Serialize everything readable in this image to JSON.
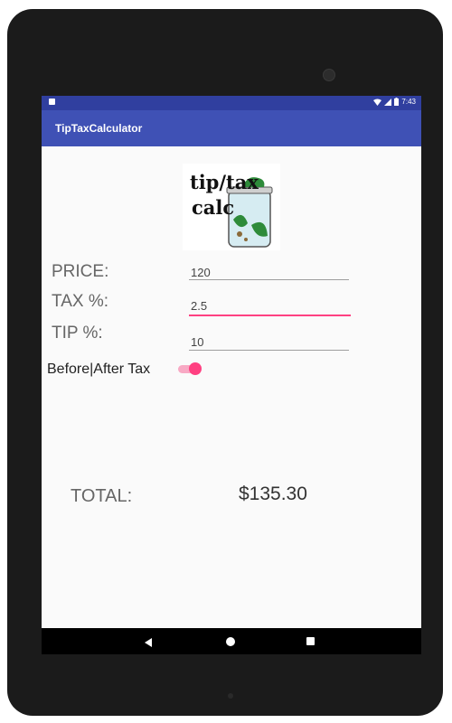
{
  "app": {
    "title": "TipTaxCalculator"
  },
  "status": {
    "time": "7:43"
  },
  "logo": {
    "line1": "tip/tax",
    "line2": "calc"
  },
  "form": {
    "price_label": "PRICE:",
    "price_value": "120",
    "tax_label": "TAX %:",
    "tax_value": "2.5",
    "tip_label": "TIP %:",
    "tip_value": "10",
    "toggle_label": "Before|After Tax",
    "toggle_on": true
  },
  "result": {
    "total_label": "TOTAL:",
    "total_value": "$135.30"
  },
  "colors": {
    "primary": "#3f51b5",
    "primary_dark": "#303f9f",
    "accent": "#ff4081"
  },
  "icons": [
    "wifi-icon",
    "signal-icon",
    "battery-icon",
    "back-icon",
    "home-icon",
    "recents-icon"
  ]
}
